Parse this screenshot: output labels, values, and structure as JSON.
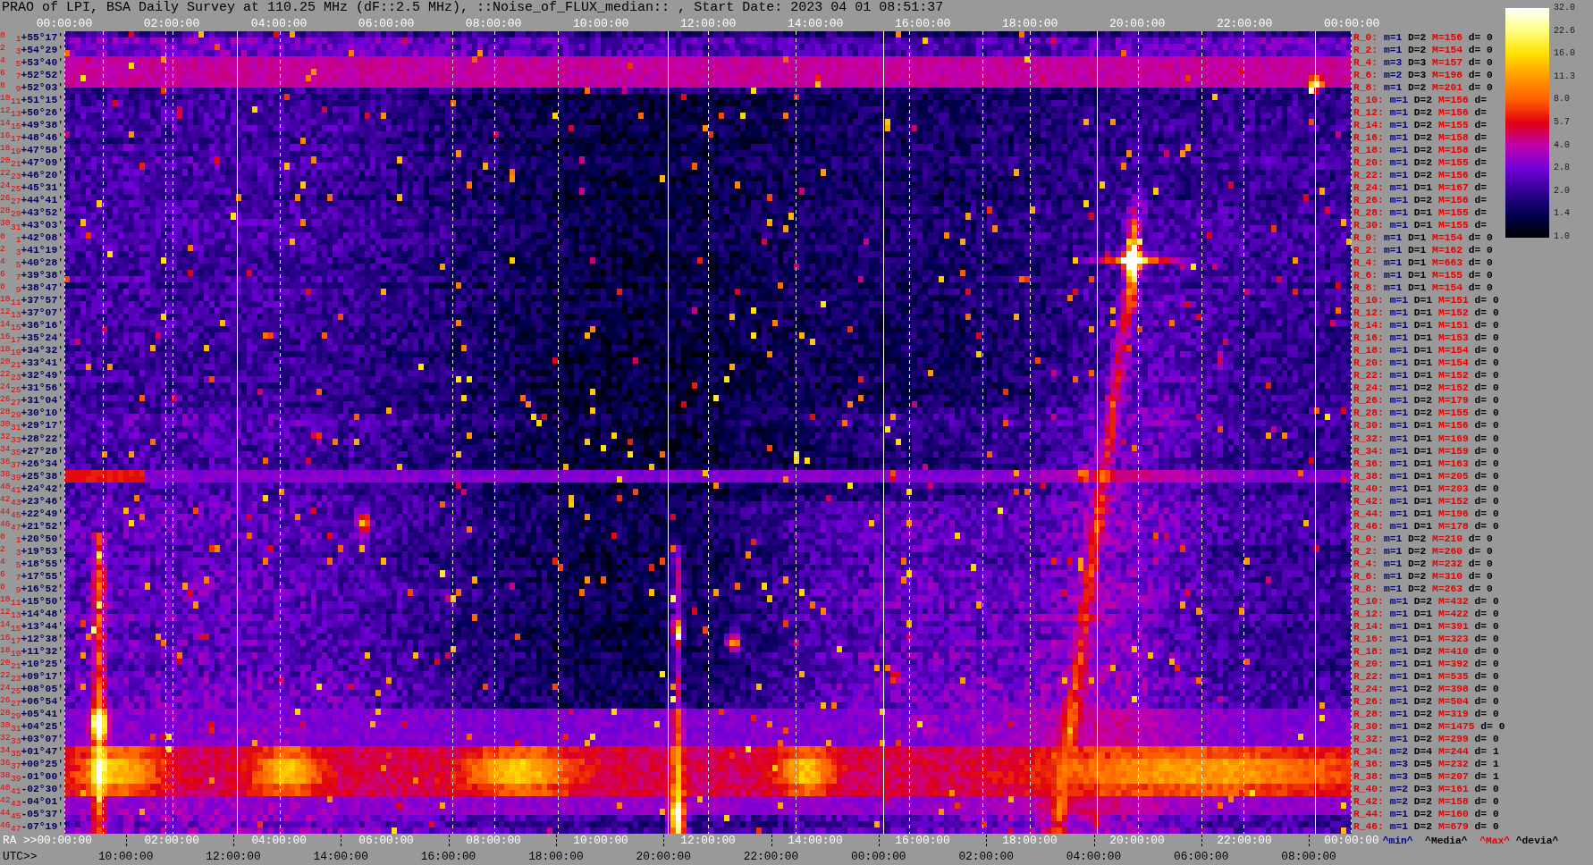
{
  "title": "PRAO of LPI, BSA Daily Survey at 110.25 MHz (dF::2.5 MHz), ::Noise_of_FLUX_median:: , Start Date: 2023 04 01 08:51:37",
  "top_axis": {
    "labels": [
      "00:00:00",
      "02:00:00",
      "04:00:00",
      "06:00:00",
      "08:00:00",
      "10:00:00",
      "12:00:00",
      "14:00:00",
      "16:00:00",
      "18:00:00",
      "20:00:00",
      "22:00:00",
      "00:00:00"
    ]
  },
  "left_axis": {
    "rows": [
      {
        "beams": [
          "0",
          "1"
        ],
        "dec": "+55°17′"
      },
      {
        "beams": [
          "2",
          "3"
        ],
        "dec": "+54°29′"
      },
      {
        "beams": [
          "4",
          "5"
        ],
        "dec": "+53°40′"
      },
      {
        "beams": [
          "6",
          "7"
        ],
        "dec": "+52°52′"
      },
      {
        "beams": [
          "8",
          "9"
        ],
        "dec": "+52°03′"
      },
      {
        "beams": [
          "10",
          "11"
        ],
        "dec": "+51°15′"
      },
      {
        "beams": [
          "12",
          "13"
        ],
        "dec": "+50°26′"
      },
      {
        "beams": [
          "14",
          "15"
        ],
        "dec": "+49°38′"
      },
      {
        "beams": [
          "16",
          "17"
        ],
        "dec": "+48°46′"
      },
      {
        "beams": [
          "18",
          "19"
        ],
        "dec": "+47°58′"
      },
      {
        "beams": [
          "20",
          "21"
        ],
        "dec": "+47°09′"
      },
      {
        "beams": [
          "22",
          "23"
        ],
        "dec": "+46°20′"
      },
      {
        "beams": [
          "24",
          "25"
        ],
        "dec": "+45°31′"
      },
      {
        "beams": [
          "26",
          "27"
        ],
        "dec": "+44°41′"
      },
      {
        "beams": [
          "28",
          "29"
        ],
        "dec": "+43°52′"
      },
      {
        "beams": [
          "30",
          "31"
        ],
        "dec": "+43°03′"
      },
      {
        "beams": [
          "0",
          "1"
        ],
        "dec": "+42°08′"
      },
      {
        "beams": [
          "2",
          "3"
        ],
        "dec": "+41°19′"
      },
      {
        "beams": [
          "4",
          "5"
        ],
        "dec": "+40°28′"
      },
      {
        "beams": [
          "6",
          "7"
        ],
        "dec": "+39°38′"
      },
      {
        "beams": [
          "8",
          "9"
        ],
        "dec": "+38°47′"
      },
      {
        "beams": [
          "10",
          "11"
        ],
        "dec": "+37°57′"
      },
      {
        "beams": [
          "12",
          "13"
        ],
        "dec": "+37°07′"
      },
      {
        "beams": [
          "14",
          "15"
        ],
        "dec": "+36°16′"
      },
      {
        "beams": [
          "16",
          "17"
        ],
        "dec": "+35°24′"
      },
      {
        "beams": [
          "18",
          "19"
        ],
        "dec": "+34°32′"
      },
      {
        "beams": [
          "20",
          "21"
        ],
        "dec": "+33°41′"
      },
      {
        "beams": [
          "22",
          "23"
        ],
        "dec": "+32°49′"
      },
      {
        "beams": [
          "24",
          "25"
        ],
        "dec": "+31°56′"
      },
      {
        "beams": [
          "26",
          "27"
        ],
        "dec": "+31°04′"
      },
      {
        "beams": [
          "28",
          "29"
        ],
        "dec": "+30°10′"
      },
      {
        "beams": [
          "30",
          "31"
        ],
        "dec": "+29°17′"
      },
      {
        "beams": [
          "32",
          "33"
        ],
        "dec": "+28°22′"
      },
      {
        "beams": [
          "34",
          "35"
        ],
        "dec": "+27°28′"
      },
      {
        "beams": [
          "36",
          "37"
        ],
        "dec": "+26°34′"
      },
      {
        "beams": [
          "38",
          "39"
        ],
        "dec": "+25°38′"
      },
      {
        "beams": [
          "40",
          "41"
        ],
        "dec": "+24°42′"
      },
      {
        "beams": [
          "42",
          "43"
        ],
        "dec": "+23°46′"
      },
      {
        "beams": [
          "44",
          "45"
        ],
        "dec": "+22°49′"
      },
      {
        "beams": [
          "46",
          "47"
        ],
        "dec": "+21°52′"
      },
      {
        "beams": [
          "0",
          "1"
        ],
        "dec": "+20°50′"
      },
      {
        "beams": [
          "2",
          "3"
        ],
        "dec": "+19°53′"
      },
      {
        "beams": [
          "4",
          "5"
        ],
        "dec": "+18°55′"
      },
      {
        "beams": [
          "6",
          "7"
        ],
        "dec": "+17°55′"
      },
      {
        "beams": [
          "8",
          "9"
        ],
        "dec": "+16°52′"
      },
      {
        "beams": [
          "10",
          "11"
        ],
        "dec": "+15°50′"
      },
      {
        "beams": [
          "12",
          "13"
        ],
        "dec": "+14°48′"
      },
      {
        "beams": [
          "14",
          "15"
        ],
        "dec": "+13°44′"
      },
      {
        "beams": [
          "16",
          "17"
        ],
        "dec": "+12°38′"
      },
      {
        "beams": [
          "18",
          "19"
        ],
        "dec": "+11°32′"
      },
      {
        "beams": [
          "20",
          "21"
        ],
        "dec": "+10°25′"
      },
      {
        "beams": [
          "22",
          "23"
        ],
        "dec": "+09°17′"
      },
      {
        "beams": [
          "24",
          "25"
        ],
        "dec": "+08°05′"
      },
      {
        "beams": [
          "26",
          "27"
        ],
        "dec": "+06°54′"
      },
      {
        "beams": [
          "28",
          "29"
        ],
        "dec": "+05°41′"
      },
      {
        "beams": [
          "30",
          "31"
        ],
        "dec": "+04°25′"
      },
      {
        "beams": [
          "32",
          "33"
        ],
        "dec": "+03°07′"
      },
      {
        "beams": [
          "34",
          "35"
        ],
        "dec": "+01°47′"
      },
      {
        "beams": [
          "36",
          "37"
        ],
        "dec": "+00°25′"
      },
      {
        "beams": [
          "38",
          "39"
        ],
        "dec": "-01°00′"
      },
      {
        "beams": [
          "40",
          "41"
        ],
        "dec": "-02°30′"
      },
      {
        "beams": [
          "42",
          "43"
        ],
        "dec": "-04°01′"
      },
      {
        "beams": [
          "44",
          "45"
        ],
        "dec": "-05°37′"
      },
      {
        "beams": [
          "46",
          "47"
        ],
        "dec": "-07°19′"
      }
    ]
  },
  "right_panel": {
    "rows": [
      {
        "beam": "R_0:",
        "min": "m=1",
        "median": "D=2",
        "max": "M=156",
        "dev": "d= 0"
      },
      {
        "beam": "R_2:",
        "min": "m=1",
        "median": "D=2",
        "max": "M=154",
        "dev": "d= 0"
      },
      {
        "beam": "R_4:",
        "min": "m=3",
        "median": "D=3",
        "max": "M=157",
        "dev": "d= 0"
      },
      {
        "beam": "R_6:",
        "min": "m=2",
        "median": "D=3",
        "max": "M=198",
        "dev": "d= 0"
      },
      {
        "beam": "R_8:",
        "min": "m=1",
        "median": "D=2",
        "max": "M=201",
        "dev": "d= 0"
      },
      {
        "beam": "R_10:",
        "min": "m=1",
        "median": "D=2",
        "max": "M=156",
        "dev": "d="
      },
      {
        "beam": "R_12:",
        "min": "m=1",
        "median": "D=2",
        "max": "M=156",
        "dev": "d="
      },
      {
        "beam": "R_14:",
        "min": "m=1",
        "median": "D=2",
        "max": "M=155",
        "dev": "d="
      },
      {
        "beam": "R_16:",
        "min": "m=1",
        "median": "D=2",
        "max": "M=158",
        "dev": "d="
      },
      {
        "beam": "R_18:",
        "min": "m=1",
        "median": "D=2",
        "max": "M=158",
        "dev": "d="
      },
      {
        "beam": "R_20:",
        "min": "m=1",
        "median": "D=2",
        "max": "M=155",
        "dev": "d="
      },
      {
        "beam": "R_22:",
        "min": "m=1",
        "median": "D=2",
        "max": "M=156",
        "dev": "d="
      },
      {
        "beam": "R_24:",
        "min": "m=1",
        "median": "D=1",
        "max": "M=167",
        "dev": "d="
      },
      {
        "beam": "R_26:",
        "min": "m=1",
        "median": "D=2",
        "max": "M=156",
        "dev": "d="
      },
      {
        "beam": "R_28:",
        "min": "m=1",
        "median": "D=1",
        "max": "M=155",
        "dev": "d="
      },
      {
        "beam": "R_30:",
        "min": "m=1",
        "median": "D=1",
        "max": "M=155",
        "dev": "d="
      },
      {
        "beam": "R_0:",
        "min": "m=1",
        "median": "D=1",
        "max": "M=154",
        "dev": "d= 0"
      },
      {
        "beam": "R_2:",
        "min": "m=1",
        "median": "D=1",
        "max": "M=162",
        "dev": "d= 0"
      },
      {
        "beam": "R_4:",
        "min": "m=1",
        "median": "D=1",
        "max": "M=663",
        "dev": "d= 0"
      },
      {
        "beam": "R_6:",
        "min": "m=1",
        "median": "D=1",
        "max": "M=155",
        "dev": "d= 0"
      },
      {
        "beam": "R_8:",
        "min": "m=1",
        "median": "D=1",
        "max": "M=154",
        "dev": "d= 0"
      },
      {
        "beam": "R_10:",
        "min": "m=1",
        "median": "D=1",
        "max": "M=151",
        "dev": "d= 0"
      },
      {
        "beam": "R_12:",
        "min": "m=1",
        "median": "D=1",
        "max": "M=152",
        "dev": "d= 0"
      },
      {
        "beam": "R_14:",
        "min": "m=1",
        "median": "D=1",
        "max": "M=151",
        "dev": "d= 0"
      },
      {
        "beam": "R_16:",
        "min": "m=1",
        "median": "D=1",
        "max": "M=153",
        "dev": "d= 0"
      },
      {
        "beam": "R_18:",
        "min": "m=1",
        "median": "D=1",
        "max": "M=154",
        "dev": "d= 0"
      },
      {
        "beam": "R_20:",
        "min": "m=1",
        "median": "D=1",
        "max": "M=154",
        "dev": "d= 0"
      },
      {
        "beam": "R_22:",
        "min": "m=1",
        "median": "D=1",
        "max": "M=152",
        "dev": "d= 0"
      },
      {
        "beam": "R_24:",
        "min": "m=1",
        "median": "D=2",
        "max": "M=152",
        "dev": "d= 0"
      },
      {
        "beam": "R_26:",
        "min": "m=1",
        "median": "D=2",
        "max": "M=179",
        "dev": "d= 0"
      },
      {
        "beam": "R_28:",
        "min": "m=1",
        "median": "D=2",
        "max": "M=155",
        "dev": "d= 0"
      },
      {
        "beam": "R_30:",
        "min": "m=1",
        "median": "D=1",
        "max": "M=156",
        "dev": "d= 0"
      },
      {
        "beam": "R_32:",
        "min": "m=1",
        "median": "D=1",
        "max": "M=169",
        "dev": "d= 0"
      },
      {
        "beam": "R_34:",
        "min": "m=1",
        "median": "D=1",
        "max": "M=159",
        "dev": "d= 0"
      },
      {
        "beam": "R_36:",
        "min": "m=1",
        "median": "D=1",
        "max": "M=163",
        "dev": "d= 0"
      },
      {
        "beam": "R_38:",
        "min": "m=1",
        "median": "D=1",
        "max": "M=205",
        "dev": "d= 0"
      },
      {
        "beam": "R_40:",
        "min": "m=1",
        "median": "D=1",
        "max": "M=203",
        "dev": "d= 0"
      },
      {
        "beam": "R_42:",
        "min": "m=1",
        "median": "D=1",
        "max": "M=152",
        "dev": "d= 0"
      },
      {
        "beam": "R_44:",
        "min": "m=1",
        "median": "D=1",
        "max": "M=196",
        "dev": "d= 0"
      },
      {
        "beam": "R_46:",
        "min": "m=1",
        "median": "D=1",
        "max": "M=178",
        "dev": "d= 0"
      },
      {
        "beam": "R_0:",
        "min": "m=1",
        "median": "D=2",
        "max": "M=210",
        "dev": "d= 0"
      },
      {
        "beam": "R_2:",
        "min": "m=1",
        "median": "D=2",
        "max": "M=260",
        "dev": "d= 0"
      },
      {
        "beam": "R_4:",
        "min": "m=1",
        "median": "D=2",
        "max": "M=232",
        "dev": "d= 0"
      },
      {
        "beam": "R_6:",
        "min": "m=1",
        "median": "D=2",
        "max": "M=310",
        "dev": "d= 0"
      },
      {
        "beam": "R_8:",
        "min": "m=1",
        "median": "D=2",
        "max": "M=263",
        "dev": "d= 0"
      },
      {
        "beam": "R_10:",
        "min": "m=1",
        "median": "D=2",
        "max": "M=432",
        "dev": "d= 0"
      },
      {
        "beam": "R_12:",
        "min": "m=1",
        "median": "D=1",
        "max": "M=422",
        "dev": "d= 0"
      },
      {
        "beam": "R_14:",
        "min": "m=1",
        "median": "D=1",
        "max": "M=391",
        "dev": "d= 0"
      },
      {
        "beam": "R_16:",
        "min": "m=1",
        "median": "D=1",
        "max": "M=323",
        "dev": "d= 0"
      },
      {
        "beam": "R_18:",
        "min": "m=1",
        "median": "D=2",
        "max": "M=410",
        "dev": "d= 0"
      },
      {
        "beam": "R_20:",
        "min": "m=1",
        "median": "D=1",
        "max": "M=392",
        "dev": "d= 0"
      },
      {
        "beam": "R_22:",
        "min": "m=1",
        "median": "D=1",
        "max": "M=535",
        "dev": "d= 0"
      },
      {
        "beam": "R_24:",
        "min": "m=1",
        "median": "D=2",
        "max": "M=398",
        "dev": "d= 0"
      },
      {
        "beam": "R_26:",
        "min": "m=1",
        "median": "D=2",
        "max": "M=504",
        "dev": "d= 0"
      },
      {
        "beam": "R_28:",
        "min": "m=1",
        "median": "D=2",
        "max": "M=319",
        "dev": "d= 0"
      },
      {
        "beam": "R_30:",
        "min": "m=1",
        "median": "D=2",
        "max": "M=1475",
        "dev": "d= 0"
      },
      {
        "beam": "R_32:",
        "min": "m=1",
        "median": "D=2",
        "max": "M=299",
        "dev": "d= 0"
      },
      {
        "beam": "R_34:",
        "min": "m=2",
        "median": "D=4",
        "max": "M=244",
        "dev": "d= 1"
      },
      {
        "beam": "R_36:",
        "min": "m=3",
        "median": "D=5",
        "max": "M=232",
        "dev": "d= 1"
      },
      {
        "beam": "R_38:",
        "min": "m=3",
        "median": "D=5",
        "max": "M=207",
        "dev": "d= 1"
      },
      {
        "beam": "R_40:",
        "min": "m=2",
        "median": "D=3",
        "max": "M=161",
        "dev": "d= 0"
      },
      {
        "beam": "R_42:",
        "min": "m=2",
        "median": "D=2",
        "max": "M=158",
        "dev": "d= 0"
      },
      {
        "beam": "R_44:",
        "min": "m=1",
        "median": "D=2",
        "max": "M=160",
        "dev": "d= 0"
      },
      {
        "beam": "R_46:",
        "min": "m=1",
        "median": "D=2",
        "max": "M=679",
        "dev": "d= 0"
      }
    ]
  },
  "colorbar": {
    "ticks": [
      "32.0",
      "22.6",
      "16.0",
      "11.3",
      "8.0",
      "5.7",
      "4.0",
      "2.8",
      "2.0",
      "1.4",
      "1.0"
    ]
  },
  "bottom_axis": {
    "ra_prefix": "RA >>",
    "ra_labels": [
      "00:00:00",
      "02:00:00",
      "04:00:00",
      "06:00:00",
      "08:00:00",
      "10:00:00",
      "12:00:00",
      "14:00:00",
      "16:00:00",
      "18:00:00",
      "20:00:00",
      "22:00:00",
      "00:00:00"
    ],
    "utc_prefix": "UTC>>",
    "utc_labels": [
      "10:00:00",
      "12:00:00",
      "14:00:00",
      "16:00:00",
      "18:00:00",
      "20:00:00",
      "22:00:00",
      "00:00:00",
      "02:00:00",
      "04:00:00",
      "06:00:00",
      "08:00:00"
    ]
  },
  "legend": [
    {
      "kind": "min",
      "label": "^min^"
    },
    {
      "kind": "median",
      "label": "^Media^"
    },
    {
      "kind": "max",
      "label": "^Max^"
    },
    {
      "kind": "deviation",
      "label": "^devia^"
    }
  ]
}
